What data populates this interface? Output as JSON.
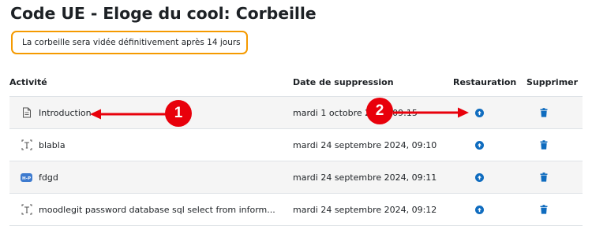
{
  "page": {
    "title": "Code UE - Eloge du cool: Corbeille"
  },
  "notice": {
    "text": "La corbeille sera vidée définitivement après 14 jours"
  },
  "table": {
    "headers": {
      "activity": "Activité",
      "deleted_on": "Date de suppression",
      "restore": "Restauration",
      "delete": "Supprimer"
    },
    "rows": [
      {
        "icon": "page-icon",
        "name": "Introduction",
        "date": "mardi 1 octobre 2024, 09:15"
      },
      {
        "icon": "text-media-icon",
        "name": "blabla",
        "date": "mardi 24 septembre 2024, 09:10"
      },
      {
        "icon": "h5p-icon",
        "name": "fdgd",
        "date": "mardi 24 septembre 2024, 09:11"
      },
      {
        "icon": "text-media-icon",
        "name": "moodlegit password database sql select from inform...",
        "date": "mardi 24 septembre 2024, 09:12"
      }
    ],
    "h5p_icon_label": "H-P"
  },
  "annotations": {
    "badge_1": "1",
    "badge_2": "2",
    "color": "#e8000b"
  },
  "colors": {
    "accent": "#0f6cbf",
    "notice_border": "#f59a00",
    "row_alt": "#f5f5f5",
    "h5p": "#3e7bcf"
  }
}
